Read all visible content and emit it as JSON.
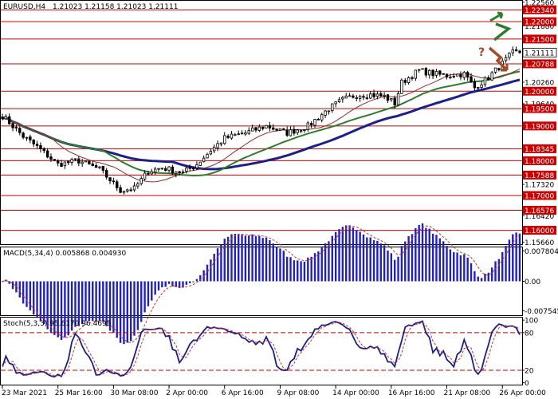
{
  "chart_data": [
    {
      "type": "candlestick",
      "title": "EURUSD,H4",
      "ohlc_header": "1.21023 1.21158 1.21023 1.21111",
      "ylim": [
        1.156,
        1.226
      ],
      "y_ticks": [
        "1.22560",
        "1.21880",
        "1.21111",
        "1.20260",
        "1.19640",
        "1.18990",
        "1.18340",
        "1.17320",
        "1.16420",
        "1.15660"
      ],
      "y_tick_values": [
        1.2256,
        1.2188,
        1.21111,
        1.2026,
        1.1964,
        1.1899,
        1.1834,
        1.1732,
        1.1642,
        1.1566
      ],
      "current_price": "1.21111",
      "current_price_value": 1.21111,
      "levels": [
        {
          "label": "1.22340",
          "value": 1.2234
        },
        {
          "label": "1.22000",
          "value": 1.22
        },
        {
          "label": "1.21500",
          "value": 1.215
        },
        {
          "label": "1.20788",
          "value": 1.20788
        },
        {
          "label": "1.20000",
          "value": 1.2
        },
        {
          "label": "1.19500",
          "value": 1.195
        },
        {
          "label": "1.19000",
          "value": 1.19
        },
        {
          "label": "1.18345",
          "value": 1.18345
        },
        {
          "label": "1.18000",
          "value": 1.18
        },
        {
          "label": "1.17588",
          "value": 1.17588
        },
        {
          "label": "1.17000",
          "value": 1.17
        },
        {
          "label": "1.16576",
          "value": 1.16576
        },
        {
          "label": "1.16000",
          "value": 1.16
        }
      ],
      "x_labels": [
        "23 Mar 2021",
        "25 Mar 16:00",
        "30 Mar 08:00",
        "2 Apr 00:00",
        "6 Apr 16:00",
        "9 Apr 08:00",
        "14 Apr 00:00",
        "16 Apr 16:00",
        "21 Apr 08:00",
        "26 Apr 00:00"
      ],
      "x_label_positions": [
        0,
        16,
        32,
        48,
        64,
        80,
        96,
        112,
        128,
        144
      ],
      "anchors": [
        [
          0,
          1.193
        ],
        [
          6,
          1.187
        ],
        [
          10,
          1.184
        ],
        [
          16,
          1.179
        ],
        [
          22,
          1.18
        ],
        [
          28,
          1.1775
        ],
        [
          34,
          1.1715
        ],
        [
          38,
          1.172
        ],
        [
          42,
          1.177
        ],
        [
          46,
          1.178
        ],
        [
          52,
          1.1765
        ],
        [
          56,
          1.179
        ],
        [
          60,
          1.183
        ],
        [
          64,
          1.1865
        ],
        [
          70,
          1.188
        ],
        [
          76,
          1.19
        ],
        [
          82,
          1.188
        ],
        [
          88,
          1.19
        ],
        [
          94,
          1.195
        ],
        [
          98,
          1.1975
        ],
        [
          102,
          1.199
        ],
        [
          106,
          1.199
        ],
        [
          110,
          1.1985
        ],
        [
          113,
          1.1965
        ],
        [
          115,
          1.2025
        ],
        [
          120,
          1.206
        ],
        [
          124,
          1.205
        ],
        [
          128,
          1.2045
        ],
        [
          133,
          1.205
        ],
        [
          136,
          1.201
        ],
        [
          140,
          1.204
        ],
        [
          144,
          1.208
        ],
        [
          147,
          1.2111
        ]
      ],
      "moving_averages": [
        {
          "color": "#1c1f8c",
          "period": 50
        },
        {
          "color": "#2e7d2e",
          "period": 30
        },
        {
          "color": "#9b2a2a",
          "period": 15
        }
      ],
      "arrow_colors": {
        "up": "#2e7d2e",
        "down": "#a64a2a"
      },
      "question_mark": "?",
      "line_color": "#cc0000",
      "level_label_bg": "#cc0000"
    },
    {
      "type": "bar",
      "title": "MACD(5,34,4) 0.005868 0.004930",
      "y_ticks": [
        "0.007804",
        "0.00",
        "-0.007545"
      ],
      "y_tick_values": [
        0.007804,
        0,
        -0.007545
      ],
      "ylim": [
        -0.0087,
        0.0087
      ],
      "bar_color": "#2222bb",
      "signal_color": "#cc3333"
    },
    {
      "type": "line",
      "title": "Stoch(5,3,3) 95.6170 96.4695",
      "y_ticks": [
        "100",
        "80",
        "20",
        "0"
      ],
      "y_tick_values": [
        100,
        80,
        20,
        0
      ],
      "ylim": [
        -3,
        104
      ],
      "main_color": "#1c1f8c",
      "signal_color": "#cc3333",
      "level_color": "#cc0000"
    }
  ]
}
